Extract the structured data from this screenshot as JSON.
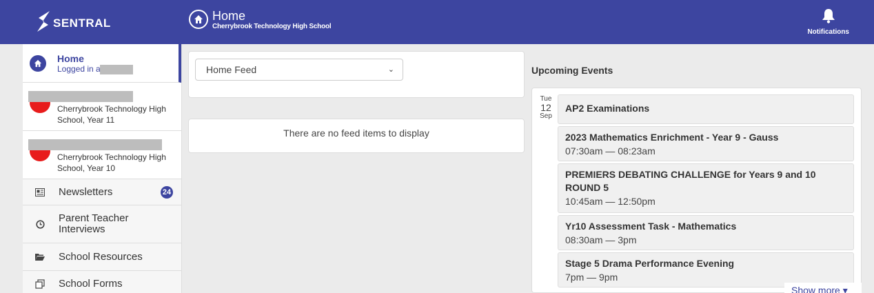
{
  "brand": {
    "name": "SENTRAL"
  },
  "header": {
    "title": "Home",
    "subtitle": "Cherrybrook Technology High School",
    "notifications_label": "Notifications"
  },
  "sidebar": {
    "home": {
      "label": "Home",
      "logged_in": "Logged in as"
    },
    "students": [
      {
        "school": "Cherrybrook Technology High School, Year 11"
      },
      {
        "school": "Cherrybrook Technology High School, Year 10"
      }
    ],
    "items": [
      {
        "label": "Newsletters",
        "icon": "newspaper-icon",
        "badge": "24"
      },
      {
        "label": "Parent Teacher Interviews",
        "icon": "clock-icon"
      },
      {
        "label": "School Resources",
        "icon": "folder-open-icon"
      },
      {
        "label": "School Forms",
        "icon": "forms-icon"
      }
    ]
  },
  "feed": {
    "selected": "Home Feed",
    "empty_message": "There are no feed items to display"
  },
  "events": {
    "title": "Upcoming Events",
    "date": {
      "weekday": "Tue",
      "day": "12",
      "month": "Sep"
    },
    "items": [
      {
        "title": "AP2 Examinations",
        "time": ""
      },
      {
        "title": "2023 Mathematics Enrichment - Year 9 - Gauss",
        "time": "07:30am — 08:23am"
      },
      {
        "title_bold": "PREMIERS DEBATING CHALLENGE",
        "title_rest": " for Years 9 and 10",
        "title_line2": "ROUND 5",
        "time": "10:45am — 12:50pm"
      },
      {
        "title": "Yr10 Assessment Task - Mathematics",
        "time": "08:30am — 3pm"
      },
      {
        "title": "Stage 5 Drama Performance Evening",
        "time": "7pm — 9pm"
      }
    ],
    "show_more": "Show more"
  },
  "colors": {
    "brand": "#3d45a0",
    "avatar": "#e81c1c"
  }
}
